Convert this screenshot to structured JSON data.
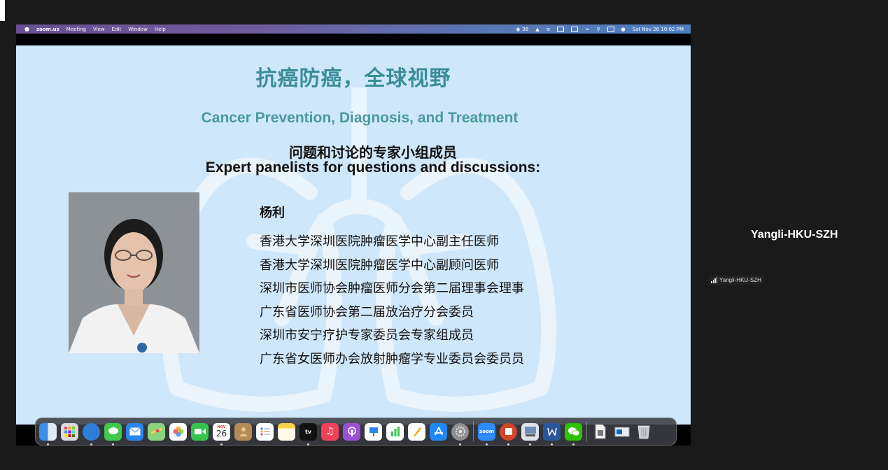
{
  "menubar": {
    "apple_icon": "",
    "app_name": "zoom.us",
    "menus": [
      "Meeting",
      "View",
      "Edit",
      "Window",
      "Help"
    ],
    "wechat_count": "38",
    "datetime": "Sat Nov 26  10:02 PM"
  },
  "slide": {
    "title_cn": "抗癌防癌，全球视野",
    "title_en": "Cancer Prevention, Diagnosis, and Treatment",
    "subtitle_cn": "问题和讨论的专家小组成员",
    "subtitle_en": "Expert panelists for questions and discussions:",
    "panelist_name": "杨利",
    "roles": [
      "香港大学深圳医院肿瘤医学中心副主任医师",
      "香港大学深圳医院肿瘤医学中心副顾问医师",
      "深圳市医师协会肿瘤医师分会第二届理事会理事",
      "广东省医师协会第二届放治疗分会委员",
      "深圳市安宁疗护专家委员会专家组成员",
      "广东省女医师办会放射肿瘤学专业委员会委员员"
    ]
  },
  "dock": {
    "calendar_month": "NOV",
    "calendar_day": "26",
    "appletv_label": "tv",
    "zoom_label": "zoom"
  },
  "participant": {
    "name": "Yangli-HKU-SZH",
    "tag": "Yangli-HKU-SZH"
  },
  "colors": {
    "slide_bg": "#cfe7fb",
    "title_teal": "#3a8e99",
    "window_bg": "#1a1a1a"
  }
}
